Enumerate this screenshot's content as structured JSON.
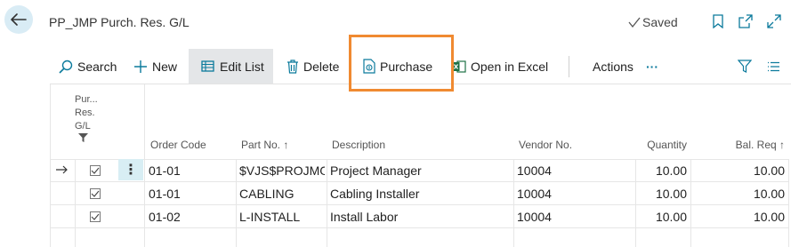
{
  "header": {
    "title": "PP_JMP Purch. Res. G/L",
    "saved_label": "Saved"
  },
  "toolbar": {
    "search_label": "Search",
    "new_label": "New",
    "edit_list_label": "Edit List",
    "delete_label": "Delete",
    "purchase_label": "Purchase",
    "open_excel_label": "Open in Excel",
    "actions_label": "Actions",
    "more_label": "···"
  },
  "grid": {
    "filter_header": [
      "Pur...",
      "Res.",
      "G/L"
    ],
    "columns": {
      "order_code": "Order Code",
      "part_no": "Part No. ↑",
      "description": "Description",
      "vendor_no": "Vendor No.",
      "quantity": "Quantity",
      "bal_req": "Bal. Req ↑"
    },
    "rows": [
      {
        "current": true,
        "checked": true,
        "order_code": "01-01",
        "part_no": "$VJS$PROJMGF",
        "description": "Project Manager",
        "vendor_no": "10004",
        "quantity": "10.00",
        "bal_req": "10.00"
      },
      {
        "current": false,
        "checked": true,
        "order_code": "01-01",
        "part_no": "CABLING",
        "description": "Cabling Installer",
        "vendor_no": "10004",
        "quantity": "10.00",
        "bal_req": "10.00"
      },
      {
        "current": false,
        "checked": true,
        "order_code": "01-02",
        "part_no": "L-INSTALL",
        "description": "Install Labor",
        "vendor_no": "10004",
        "quantity": "10.00",
        "bal_req": "10.00"
      }
    ]
  },
  "colors": {
    "accent": "#0b7a9c",
    "highlight_box": "#f08a31",
    "back_button_bg": "#d9ecf5",
    "excel_green": "#1e7145"
  }
}
